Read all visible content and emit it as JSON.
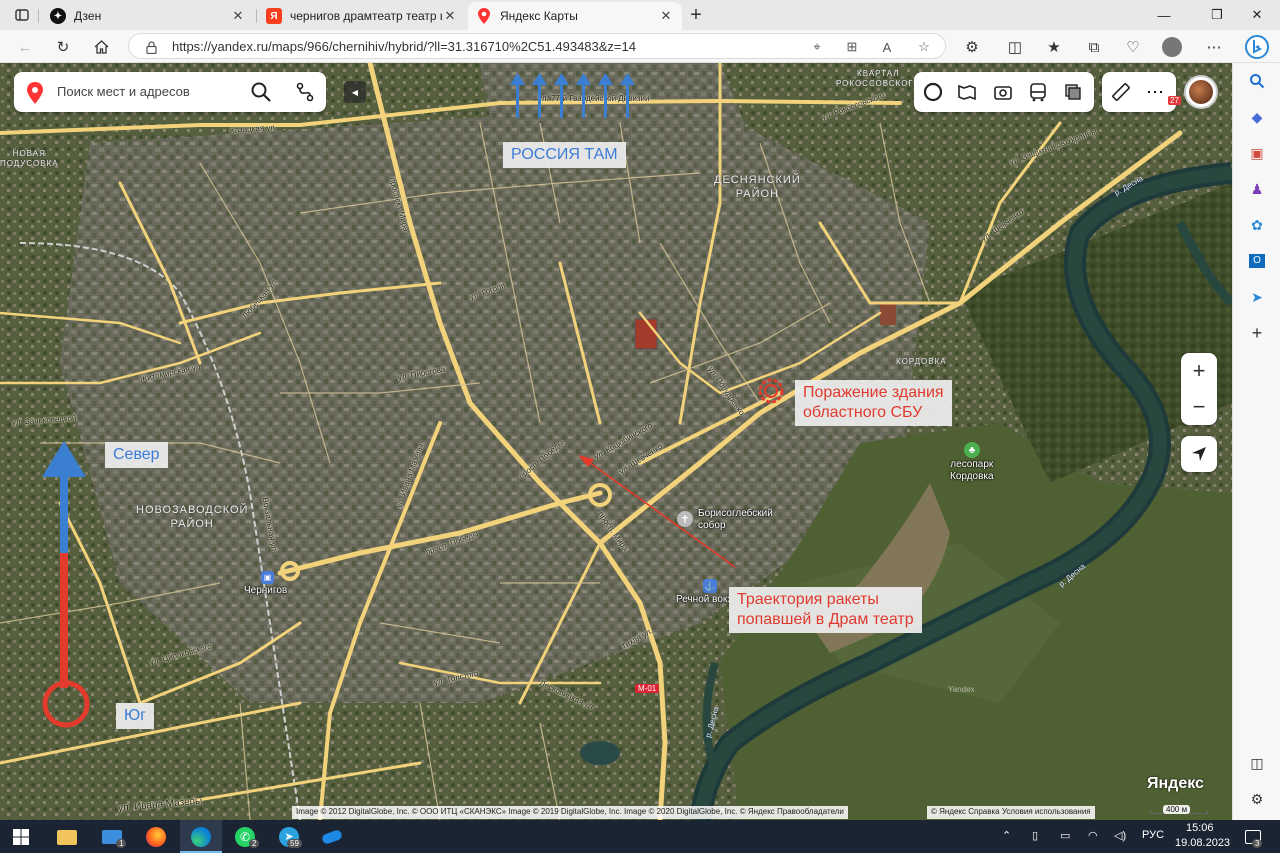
{
  "browser": {
    "tabs": [
      {
        "title": "Дзен",
        "active": false,
        "icon": "dzen-icon"
      },
      {
        "title": "чернигов драмтеатр театр шевч",
        "active": false,
        "icon": "yandex-search-icon"
      },
      {
        "title": "Яндекс Карты",
        "active": true,
        "icon": "yandex-maps-icon"
      }
    ],
    "new_tab": "+",
    "url": "https://yandex.ru/maps/966/chernihiv/hybrid/?ll=31.316710%2C51.493483&z=14"
  },
  "map": {
    "search_placeholder": "Поиск мест и адресов",
    "avatar_badge": "27",
    "zoom_in": "+",
    "zoom_out": "−",
    "districts": {
      "desnyansky": "ДЕСНЯНСКИЙ\nРАЙОН",
      "novozavodskoy": "НОВОЗАВОДСКОЙ\nРАЙОН",
      "kordovka": "КОРДОВКА",
      "kvartal": "КВАРТАЛ\nРОКОССОВСКОГО",
      "novaya_podusovka": "НОВАЯ\nПОДУСОВКА"
    },
    "roads": {
      "guards_division": "ул. 77-й Гвардейской Дивизии",
      "kazatskaya": "Казацкая ул.",
      "prospekt_mira": "проспект Мира",
      "ivana_mazepy": "ул. Ивана Мазепы",
      "shevchenko_1": "ул. Шевченко",
      "shevchenko_2": "ул. Шевченко",
      "pr_pobedy": "просп. Победы",
      "pr_pobedy_2": "просп. Победы",
      "pr_mira_s": "просп. Мира",
      "zankovetskoy": "ул. Заньковецкой",
      "pirogova": "ул. Пирогова",
      "tolstogo": "ул. Толстого",
      "lesko": "Лесковицкая ул.",
      "gogolya": "ул. Гоголя",
      "kotsyubinskogo": "ул. Коцюбинского",
      "popudrenko": "ул. Попудренко",
      "ryabova": "ул. Рокоссовского",
      "lyubetskaya": "Любецкая ул.",
      "zhitomirskaya": "Житомирская ул.",
      "ciolkovsky": "ул. Циолковского",
      "tikhaya": "Тихая ул.",
      "m01": "М-01",
      "ivana_mazepy_2": "ул. Ивана Мазепы",
      "shevchenko_3": "ул. Шевченко",
      "zaschitnikov": "ул. Защитников Украины",
      "vokzalnaya": "Вокзальная ул."
    },
    "rivers": {
      "desna_1": "р. Десна",
      "desna_2": "р. Десна",
      "desna_3": "р. Десна"
    },
    "pois": {
      "sobor": "Борисоглебский\nсобор",
      "vokzal": "Речной вокз.",
      "chernigov": "Чернигов",
      "lesopark": "лесопарк\nКордовка"
    },
    "annotations": {
      "russia": "РОССИЯ ТАМ",
      "sever": "Север",
      "yug": "Юг",
      "sbu": "Поражение здания\nобластного СБУ",
      "rocket": "Траектория ракеты\nпопавшей в Драм театр"
    },
    "annotation_colors": {
      "red": "#e03a2e",
      "blue": "#3c7bd6"
    },
    "copyright": "Image © 2012 DigitalGlobe, Inc. © ООО ИТЦ «СКАНЭКС» Image © 2019 DigitalGlobe, Inc. Image © 2020 DigitalGlobe, Inc. © Яндекс   Правообладатели",
    "legal": "© Яндекс   Справка   Условия использования",
    "logo": "Яндекс",
    "scale": "400 м",
    "watermark": "Yandex"
  },
  "taskbar": {
    "badges": {
      "mail": "1",
      "whatsapp": "2",
      "telegram": "59"
    },
    "language": "РУС",
    "time": "15:06",
    "date": "19.08.2023",
    "notifications": "3"
  }
}
